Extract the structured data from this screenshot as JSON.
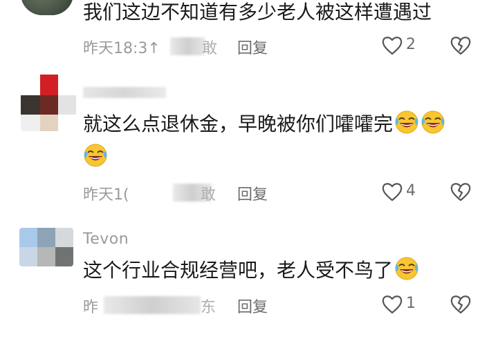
{
  "comments": [
    {
      "username": "",
      "text": "我们这边不知道有多少老人被这样遭遇过",
      "time": "昨天18:3↑",
      "location_fragment": "敢",
      "reply_label": "回复",
      "likes": "2",
      "emoji_count": 0
    },
    {
      "username": "",
      "text": "就这么点退休金，早晚被你们嚯嚯完",
      "time": "昨天1(",
      "location_fragment": "敢",
      "reply_label": "回复",
      "likes": "4",
      "emoji_count": 3
    },
    {
      "username": "Tevon",
      "text": "这个行业合规经营吧，老人受不鸟了",
      "time": "昨",
      "location_fragment": "东",
      "reply_label": "回复",
      "likes": "1",
      "emoji_count": 1
    }
  ],
  "icons": {
    "like": "heart-outline-icon",
    "dislike": "broken-heart-icon",
    "emoji": "rolling-on-floor-laughing-emoji"
  },
  "colors": {
    "text": "#1a1a1a",
    "meta": "#9a9a9a",
    "action": "#6b6b6b",
    "emoji_face": "#f7c631"
  }
}
